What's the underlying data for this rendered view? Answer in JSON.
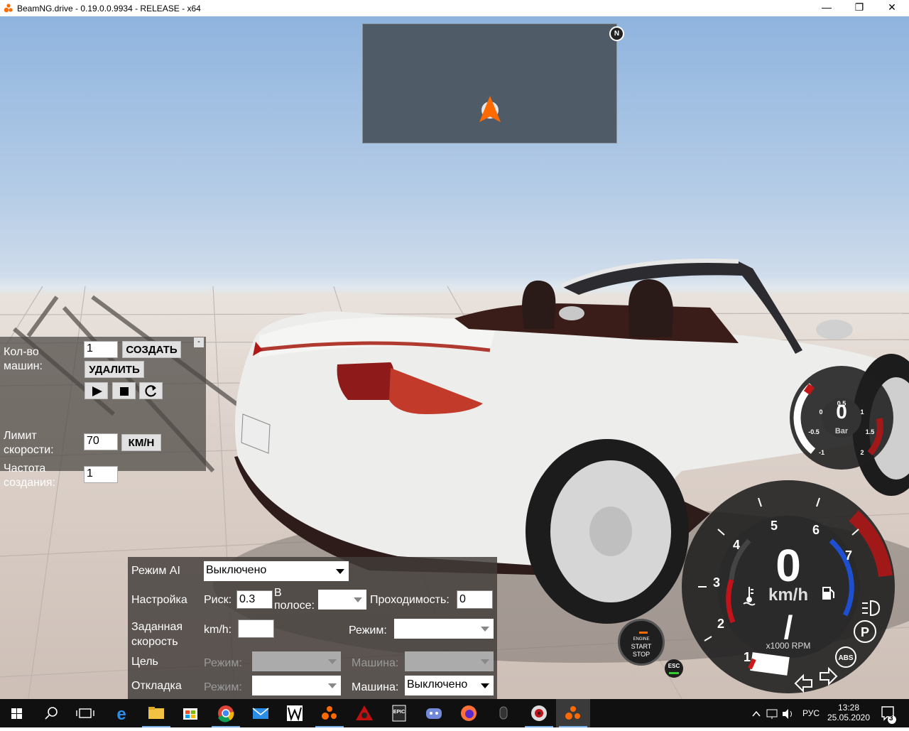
{
  "window": {
    "title": "BeamNG.drive - 0.19.0.0.9934 - RELEASE - x64",
    "minimize": "—",
    "maximize": "❐",
    "close": "✕"
  },
  "minimap": {
    "north_label": "N"
  },
  "traffic_panel": {
    "count_label": "Кол-во\nмашин:",
    "count_value": "1",
    "create_label": "СОЗДАТЬ",
    "delete_label": "УДАЛИТЬ",
    "collapse_label": "-",
    "speed_limit_label": "Лимит\nскорости:",
    "speed_limit_value": "70",
    "speed_unit_label": "КМ/Н",
    "spawn_rate_label": "Частота\nсоздания:",
    "spawn_rate_value": "1"
  },
  "ai_panel": {
    "mode_label": "Режим AI",
    "mode_value": "Выключено",
    "setup_label": "Настройка",
    "risk_label": "Риск:",
    "risk_value": "0.3",
    "in_lane_label": "В\nполосе:",
    "in_lane_value": "",
    "passability_label": "Проходимость:",
    "passability_value": "0",
    "target_speed_label": "Заданная\nскорость",
    "kmh_label": "km/h:",
    "kmh_value": "",
    "speed_mode_label": "Режим:",
    "speed_mode_value": "",
    "target_label": "Цель",
    "target_mode_label": "Режим:",
    "target_mode_value": "",
    "target_vehicle_label": "Машина:",
    "target_vehicle_value": "",
    "debug_label": "Откладка",
    "debug_mode_label": "Режим:",
    "debug_mode_value": "",
    "debug_vehicle_label": "Машина:",
    "debug_vehicle_value": "Выключено"
  },
  "boost_gauge": {
    "value": "0",
    "unit": "Bar",
    "ticks": [
      "-1",
      "-0.5",
      "0",
      "0.5",
      "1",
      "1.5",
      "2"
    ]
  },
  "tacho": {
    "speed": "0",
    "speed_unit": "km/h",
    "gear": "/",
    "rpm_label": "x1000 RPM",
    "rpm_ticks": [
      "1",
      "2",
      "3",
      "4",
      "5",
      "6",
      "7"
    ]
  },
  "engine_button": {
    "line1": "ENGINE",
    "line2": "START",
    "line3": "STOP"
  },
  "esc_label": "ESC",
  "taskbar": {
    "lang": "РУС",
    "time": "13:28",
    "date": "25.05.2020",
    "notifications": "3"
  },
  "colors": {
    "accent_orange": "#ff6a00",
    "redline": "#a01818",
    "temp_red": "#c0141a",
    "fuel_blue": "#1d4fd0",
    "panel_bg": "#4b4642"
  }
}
